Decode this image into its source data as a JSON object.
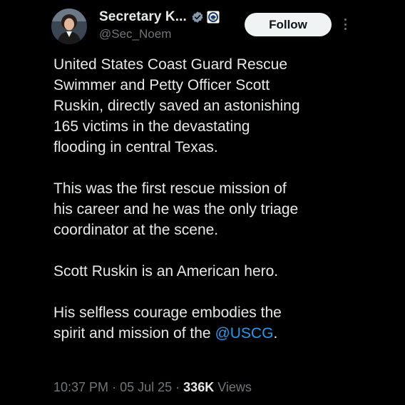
{
  "author": {
    "display_name": "Secretary K...",
    "handle": "@Sec_Noem",
    "verified_icon": "verified-badge-icon",
    "affiliation_icon": "dhs-seal-icon"
  },
  "actions": {
    "follow_label": "Follow",
    "more_icon": "more-vertical-icon"
  },
  "tweet": {
    "paragraphs": [
      {
        "lines": [
          "United States Coast Guard Rescue",
          "Swimmer and Petty Officer Scott",
          "Ruskin, directly saved an astonishing",
          "165 victims in the devastating",
          "flooding in central Texas."
        ]
      },
      {
        "lines": [
          "This was the first rescue mission of",
          "his career and he was the only triage",
          "coordinator at the scene."
        ]
      },
      {
        "lines": [
          "Scott Ruskin is an American hero."
        ]
      },
      {
        "lines": [
          "His selfless courage embodies the",
          "spirit and mission of the "
        ],
        "mention": "@USCG",
        "after_mention": "."
      }
    ]
  },
  "meta": {
    "time": "10:37 PM",
    "separator": "·",
    "date": "05 Jul 25",
    "views_count": "336K",
    "views_label": "Views"
  },
  "colors": {
    "background": "#000000",
    "text": "#e7e9ea",
    "secondary": "#71767b",
    "link": "#1d9bf0",
    "verified": "#829aab"
  }
}
